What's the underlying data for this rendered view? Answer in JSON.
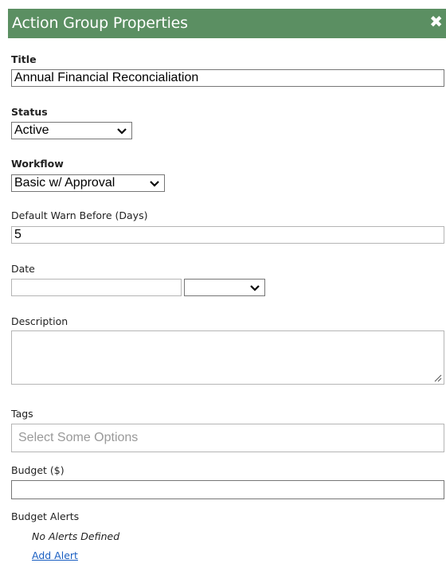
{
  "header": {
    "title": "Action Group Properties",
    "close_icon": "close-icon",
    "color": "#5b8f62"
  },
  "fields": {
    "title": {
      "label": "Title",
      "value": "Annual Financial Reconcialiation"
    },
    "status": {
      "label": "Status",
      "value": "Active"
    },
    "workflow": {
      "label": "Workflow",
      "value": "Basic w/ Approval"
    },
    "warn": {
      "label": "Default Warn Before (Days)",
      "value": "5"
    },
    "date": {
      "label": "Date",
      "value": "",
      "time_value": ""
    },
    "description": {
      "label": "Description",
      "value": ""
    },
    "tags": {
      "label": "Tags",
      "placeholder": "Select Some Options"
    },
    "budget": {
      "label": "Budget ($)",
      "value": ""
    },
    "budget_alerts": {
      "label": "Budget Alerts",
      "empty_text": "No Alerts Defined",
      "add_link": "Add Alert"
    }
  }
}
